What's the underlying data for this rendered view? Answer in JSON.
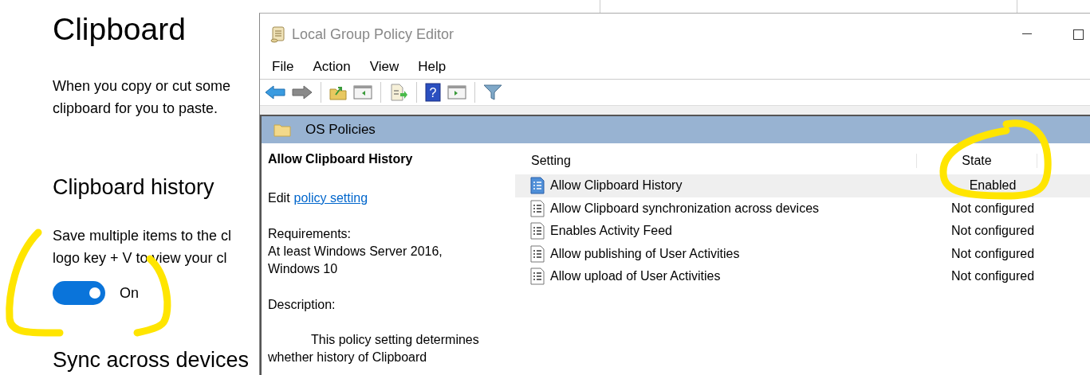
{
  "settings": {
    "title": "Clipboard",
    "intro": [
      "When you copy or cut some",
      "clipboard for you to paste."
    ],
    "history": {
      "heading": "Clipboard history",
      "description": [
        "Save multiple items to the cl",
        "logo key + V to view your cl"
      ],
      "toggle": {
        "on": true,
        "label": "On"
      }
    },
    "sync_heading": "Sync across devices"
  },
  "window": {
    "title": "Local Group Policy Editor",
    "menu": [
      "File",
      "Action",
      "View",
      "Help"
    ],
    "help_glyph": "?"
  },
  "node": {
    "title": "OS Policies"
  },
  "details": {
    "title": "Allow Clipboard History",
    "edit_prefix": "Edit",
    "edit_link": "policy setting",
    "requirements_label": "Requirements:",
    "requirements": [
      "At least Windows Server 2016,",
      "Windows 10"
    ],
    "description_label": "Description:",
    "description": [
      "This policy setting determines",
      "whether history of Clipboard"
    ]
  },
  "table": {
    "columns": [
      "Setting",
      "State"
    ],
    "rows": [
      {
        "setting": "Allow Clipboard History",
        "state": "Enabled",
        "selected": true
      },
      {
        "setting": "Allow Clipboard synchronization across devices",
        "state": "Not configured",
        "selected": false
      },
      {
        "setting": "Enables Activity Feed",
        "state": "Not configured",
        "selected": false
      },
      {
        "setting": "Allow publishing of User Activities",
        "state": "Not configured",
        "selected": false
      },
      {
        "setting": "Allow upload of User Activities",
        "state": "Not configured",
        "selected": false
      }
    ]
  }
}
